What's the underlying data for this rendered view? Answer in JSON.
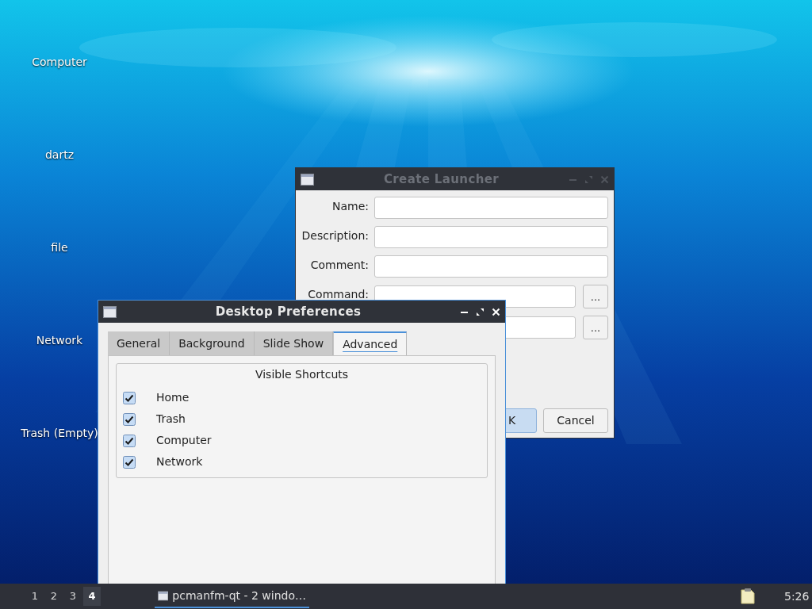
{
  "desktop_icons": [
    {
      "label": "Computer"
    },
    {
      "label": "dartz"
    },
    {
      "label": "file"
    },
    {
      "label": "Network"
    },
    {
      "label": "Trash (Empty)"
    }
  ],
  "launcher": {
    "title": "Create Launcher",
    "active": false,
    "fields": [
      {
        "label": "Name:"
      },
      {
        "label": "Description:"
      },
      {
        "label": "Comment:"
      },
      {
        "label": "Command:",
        "browse": "..."
      },
      {
        "browse": "..."
      }
    ],
    "buttons": [
      {
        "label": "K",
        "default": true
      },
      {
        "label": "Cancel",
        "default": false
      }
    ]
  },
  "preferences": {
    "title": "Desktop Preferences",
    "active": true,
    "tabs": [
      {
        "label": "General",
        "selected": false
      },
      {
        "label": "Background",
        "selected": false
      },
      {
        "label": "Slide Show",
        "selected": false
      },
      {
        "label": "Advanced",
        "selected": true
      }
    ],
    "group_title": "Visible Shortcuts",
    "shortcuts": [
      {
        "label": "Home",
        "checked": true
      },
      {
        "label": "Trash",
        "checked": true
      },
      {
        "label": "Computer",
        "checked": true
      },
      {
        "label": "Network",
        "checked": true
      }
    ]
  },
  "taskbar": {
    "workspaces": [
      {
        "label": "1",
        "selected": false
      },
      {
        "label": "2",
        "selected": false
      },
      {
        "label": "3",
        "selected": false
      },
      {
        "label": "4",
        "selected": true
      }
    ],
    "task": {
      "label": "pcmanfm-qt - 2 windo…",
      "active": true
    },
    "clock": "5:26"
  }
}
